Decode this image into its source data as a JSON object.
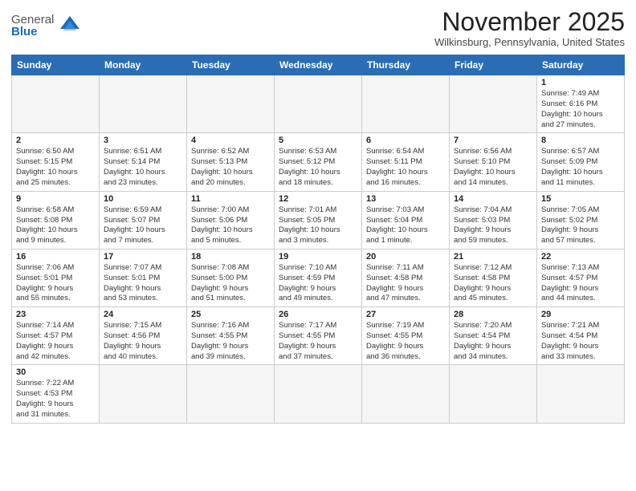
{
  "logo": {
    "general": "General",
    "blue": "Blue"
  },
  "title": "November 2025",
  "location": "Wilkinsburg, Pennsylvania, United States",
  "weekdays": [
    "Sunday",
    "Monday",
    "Tuesday",
    "Wednesday",
    "Thursday",
    "Friday",
    "Saturday"
  ],
  "weeks": [
    [
      {
        "day": "",
        "info": ""
      },
      {
        "day": "",
        "info": ""
      },
      {
        "day": "",
        "info": ""
      },
      {
        "day": "",
        "info": ""
      },
      {
        "day": "",
        "info": ""
      },
      {
        "day": "",
        "info": ""
      },
      {
        "day": "1",
        "info": "Sunrise: 7:49 AM\nSunset: 6:16 PM\nDaylight: 10 hours\nand 27 minutes."
      }
    ],
    [
      {
        "day": "2",
        "info": "Sunrise: 6:50 AM\nSunset: 5:15 PM\nDaylight: 10 hours\nand 25 minutes."
      },
      {
        "day": "3",
        "info": "Sunrise: 6:51 AM\nSunset: 5:14 PM\nDaylight: 10 hours\nand 23 minutes."
      },
      {
        "day": "4",
        "info": "Sunrise: 6:52 AM\nSunset: 5:13 PM\nDaylight: 10 hours\nand 20 minutes."
      },
      {
        "day": "5",
        "info": "Sunrise: 6:53 AM\nSunset: 5:12 PM\nDaylight: 10 hours\nand 18 minutes."
      },
      {
        "day": "6",
        "info": "Sunrise: 6:54 AM\nSunset: 5:11 PM\nDaylight: 10 hours\nand 16 minutes."
      },
      {
        "day": "7",
        "info": "Sunrise: 6:56 AM\nSunset: 5:10 PM\nDaylight: 10 hours\nand 14 minutes."
      },
      {
        "day": "8",
        "info": "Sunrise: 6:57 AM\nSunset: 5:09 PM\nDaylight: 10 hours\nand 11 minutes."
      }
    ],
    [
      {
        "day": "9",
        "info": "Sunrise: 6:58 AM\nSunset: 5:08 PM\nDaylight: 10 hours\nand 9 minutes."
      },
      {
        "day": "10",
        "info": "Sunrise: 6:59 AM\nSunset: 5:07 PM\nDaylight: 10 hours\nand 7 minutes."
      },
      {
        "day": "11",
        "info": "Sunrise: 7:00 AM\nSunset: 5:06 PM\nDaylight: 10 hours\nand 5 minutes."
      },
      {
        "day": "12",
        "info": "Sunrise: 7:01 AM\nSunset: 5:05 PM\nDaylight: 10 hours\nand 3 minutes."
      },
      {
        "day": "13",
        "info": "Sunrise: 7:03 AM\nSunset: 5:04 PM\nDaylight: 10 hours\nand 1 minute."
      },
      {
        "day": "14",
        "info": "Sunrise: 7:04 AM\nSunset: 5:03 PM\nDaylight: 9 hours\nand 59 minutes."
      },
      {
        "day": "15",
        "info": "Sunrise: 7:05 AM\nSunset: 5:02 PM\nDaylight: 9 hours\nand 57 minutes."
      }
    ],
    [
      {
        "day": "16",
        "info": "Sunrise: 7:06 AM\nSunset: 5:01 PM\nDaylight: 9 hours\nand 55 minutes."
      },
      {
        "day": "17",
        "info": "Sunrise: 7:07 AM\nSunset: 5:01 PM\nDaylight: 9 hours\nand 53 minutes."
      },
      {
        "day": "18",
        "info": "Sunrise: 7:08 AM\nSunset: 5:00 PM\nDaylight: 9 hours\nand 51 minutes."
      },
      {
        "day": "19",
        "info": "Sunrise: 7:10 AM\nSunset: 4:59 PM\nDaylight: 9 hours\nand 49 minutes."
      },
      {
        "day": "20",
        "info": "Sunrise: 7:11 AM\nSunset: 4:58 PM\nDaylight: 9 hours\nand 47 minutes."
      },
      {
        "day": "21",
        "info": "Sunrise: 7:12 AM\nSunset: 4:58 PM\nDaylight: 9 hours\nand 45 minutes."
      },
      {
        "day": "22",
        "info": "Sunrise: 7:13 AM\nSunset: 4:57 PM\nDaylight: 9 hours\nand 44 minutes."
      }
    ],
    [
      {
        "day": "23",
        "info": "Sunrise: 7:14 AM\nSunset: 4:57 PM\nDaylight: 9 hours\nand 42 minutes."
      },
      {
        "day": "24",
        "info": "Sunrise: 7:15 AM\nSunset: 4:56 PM\nDaylight: 9 hours\nand 40 minutes."
      },
      {
        "day": "25",
        "info": "Sunrise: 7:16 AM\nSunset: 4:55 PM\nDaylight: 9 hours\nand 39 minutes."
      },
      {
        "day": "26",
        "info": "Sunrise: 7:17 AM\nSunset: 4:55 PM\nDaylight: 9 hours\nand 37 minutes."
      },
      {
        "day": "27",
        "info": "Sunrise: 7:19 AM\nSunset: 4:55 PM\nDaylight: 9 hours\nand 36 minutes."
      },
      {
        "day": "28",
        "info": "Sunrise: 7:20 AM\nSunset: 4:54 PM\nDaylight: 9 hours\nand 34 minutes."
      },
      {
        "day": "29",
        "info": "Sunrise: 7:21 AM\nSunset: 4:54 PM\nDaylight: 9 hours\nand 33 minutes."
      }
    ],
    [
      {
        "day": "30",
        "info": "Sunrise: 7:22 AM\nSunset: 4:53 PM\nDaylight: 9 hours\nand 31 minutes."
      },
      {
        "day": "",
        "info": ""
      },
      {
        "day": "",
        "info": ""
      },
      {
        "day": "",
        "info": ""
      },
      {
        "day": "",
        "info": ""
      },
      {
        "day": "",
        "info": ""
      },
      {
        "day": "",
        "info": ""
      }
    ]
  ]
}
